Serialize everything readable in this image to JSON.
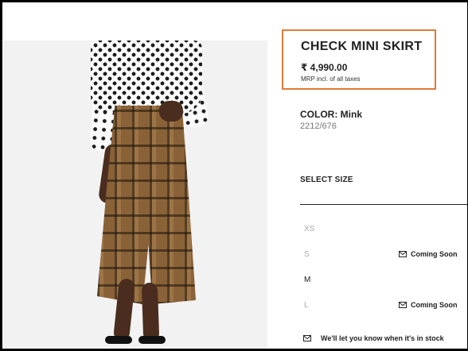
{
  "product": {
    "title": "CHECK MINI SKIRT",
    "price": "₹ 4,990.00",
    "tax_note": "MRP incl. of all taxes"
  },
  "color": {
    "label": "COLOR: Mink",
    "sku": "2212/676"
  },
  "size_selector": {
    "heading": "SELECT SIZE",
    "sizes": [
      {
        "label": "XS",
        "status": ""
      },
      {
        "label": "S",
        "status": "Coming Soon"
      },
      {
        "label": "M",
        "status": ""
      },
      {
        "label": "L",
        "status": "Coming Soon"
      }
    ],
    "notify_text": "We'll let you know when it's in stock"
  },
  "colors": {
    "highlight_border": "#e07b39",
    "text": "#222222",
    "muted": "#aaaaaa"
  },
  "icons": {
    "mail": "envelope-icon"
  }
}
